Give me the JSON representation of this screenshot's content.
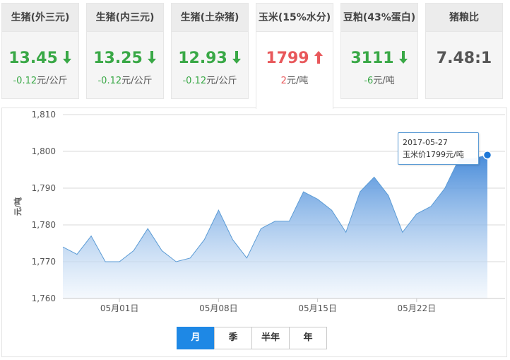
{
  "tiles": [
    {
      "name": "生猪(外三元)",
      "value": "13.45",
      "direction": "down",
      "change": "-0.12",
      "unit": "元/公斤",
      "color": "#39a846"
    },
    {
      "name": "生猪(内三元)",
      "value": "13.25",
      "direction": "down",
      "change": "-0.12",
      "unit": "元/公斤",
      "color": "#39a846"
    },
    {
      "name": "生猪(土杂猪)",
      "value": "12.93",
      "direction": "down",
      "change": "-0.12",
      "unit": "元/公斤",
      "color": "#39a846"
    },
    {
      "name": "玉米(15%水分)",
      "value": "1799",
      "direction": "up",
      "change": "2",
      "unit": "元/吨",
      "color": "#e8585b"
    },
    {
      "name": "豆粕(43%蛋白)",
      "value": "3111",
      "direction": "down",
      "change": "-6",
      "unit": "元/吨",
      "color": "#39a846"
    },
    {
      "name": "猪粮比",
      "value": "7.48:1",
      "color": "#555555"
    }
  ],
  "tooltip": {
    "date": "2017-05-27",
    "text": "玉米价1799元/吨"
  },
  "range_buttons": [
    "月",
    "季",
    "半年",
    "年"
  ],
  "active_range": "月",
  "colors": {
    "line": "#5b9bd5",
    "fill_top": "#3f86d8",
    "fill_bottom": "#eef5fc",
    "grid": "#d8d8d8"
  },
  "chart_data": {
    "type": "area",
    "ylabel": "元/吨",
    "ylim": [
      1760,
      1810
    ],
    "yticks": [
      1760,
      1770,
      1780,
      1790,
      1800,
      1810
    ],
    "yticklabels": [
      "1,760",
      "1,770",
      "1,780",
      "1,790",
      "1,800",
      "1,810"
    ],
    "xticks": [
      "2017-05-01",
      "2017-05-08",
      "2017-05-15",
      "2017-05-22"
    ],
    "xticklabels": [
      "05月01日",
      "05月08日",
      "05月15日",
      "05月22日"
    ],
    "x": [
      "2017-04-27",
      "2017-04-28",
      "2017-04-29",
      "2017-04-30",
      "2017-05-01",
      "2017-05-02",
      "2017-05-03",
      "2017-05-04",
      "2017-05-05",
      "2017-05-06",
      "2017-05-07",
      "2017-05-08",
      "2017-05-09",
      "2017-05-10",
      "2017-05-11",
      "2017-05-12",
      "2017-05-13",
      "2017-05-14",
      "2017-05-15",
      "2017-05-16",
      "2017-05-17",
      "2017-05-18",
      "2017-05-19",
      "2017-05-20",
      "2017-05-21",
      "2017-05-22",
      "2017-05-23",
      "2017-05-24",
      "2017-05-25",
      "2017-05-26",
      "2017-05-27"
    ],
    "series": [
      {
        "values": [
          1774,
          1772,
          1777,
          1770,
          1770,
          1773,
          1779,
          1773,
          1770,
          1771,
          1776,
          1784,
          1776,
          1771,
          1779,
          1781,
          1781,
          1789,
          1787,
          1784,
          1778,
          1789,
          1793,
          1788,
          1778,
          1783,
          1785,
          1790,
          1798,
          1798,
          1799
        ]
      }
    ],
    "highlight_index": 30,
    "grid": true,
    "legend": "none"
  }
}
